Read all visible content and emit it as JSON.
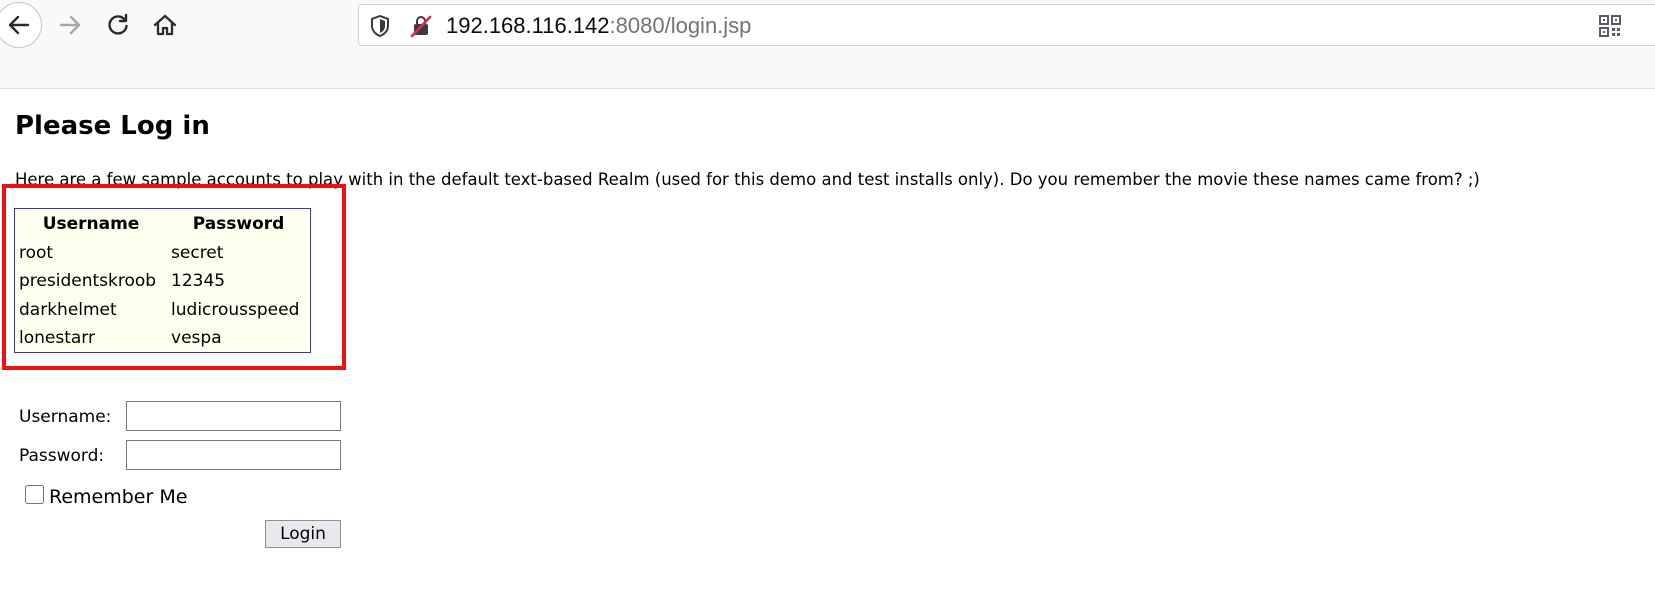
{
  "browser": {
    "url_host": "192.168.116.142",
    "url_rest": ":8080/login.jsp"
  },
  "page": {
    "title": "Please Log in",
    "intro": "Here are a few sample accounts to play with in the default text-based Realm (used for this demo and test installs only). Do you remember the movie these names came from? ;)"
  },
  "accounts": {
    "headers": [
      "Username",
      "Password"
    ],
    "rows": [
      [
        "root",
        "secret"
      ],
      [
        "presidentskroob",
        "12345"
      ],
      [
        "darkhelmet",
        "ludicrousspeed"
      ],
      [
        "lonestarr",
        "vespa"
      ]
    ]
  },
  "form": {
    "username_label": "Username:",
    "username_value": "",
    "password_label": "Password:",
    "password_value": "",
    "remember_label": "Remember Me",
    "login_label": "Login"
  },
  "colors": {
    "highlight": "#ee1111",
    "table_border": "#3333cc",
    "table_bg": "#fffff0"
  }
}
